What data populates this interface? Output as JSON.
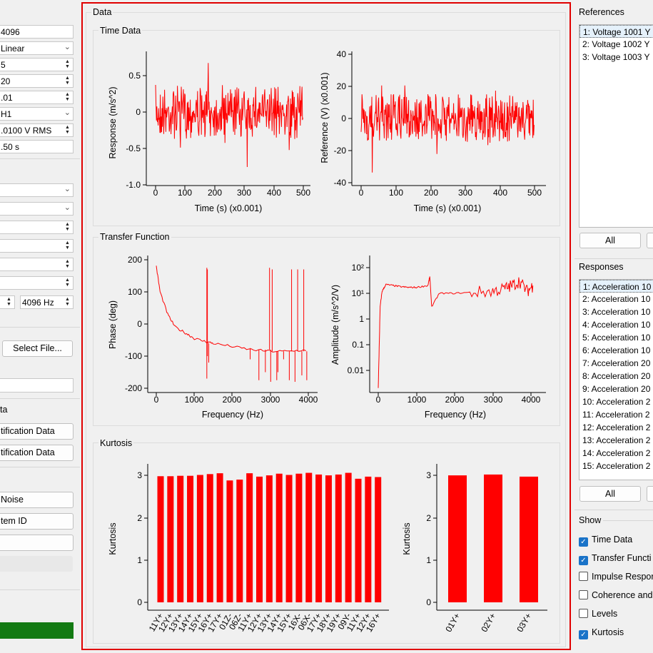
{
  "left_panel": {
    "fields": [
      {
        "text": "4096",
        "kind": "text"
      },
      {
        "text": "Linear",
        "kind": "combo"
      },
      {
        "text": "5",
        "kind": "spin"
      },
      {
        "text": "20",
        "kind": "spin"
      },
      {
        "text": ".01",
        "kind": "spin"
      },
      {
        "text": "H1",
        "kind": "combo"
      },
      {
        "text": ".0100 V RMS",
        "kind": "spin"
      },
      {
        "text": ".50 s",
        "kind": "text"
      }
    ],
    "freq_field": "4096 Hz",
    "select_file_label": "Select File...",
    "section_label_ta": "ta",
    "identification_buttons": [
      "tification Data",
      "tification Data"
    ],
    "noise_button": "Noise",
    "system_id_button": "tem ID"
  },
  "data_panel": {
    "title": "Data",
    "time_data": {
      "title": "Time Data",
      "response_plot": {
        "ylabel": "Response (m/s^2)",
        "xlabel": "Time (s) (x0.001)",
        "yticks": [
          "0.5",
          "0",
          "-0.5",
          "-1.0"
        ],
        "xticks": [
          "0",
          "100",
          "200",
          "300",
          "400",
          "500"
        ]
      },
      "reference_plot": {
        "ylabel": "Reference (V) (x0.001)",
        "xlabel": "Time (s) (x0.001)",
        "yticks": [
          "40",
          "20",
          "0",
          "-20",
          "-40"
        ],
        "xticks": [
          "0",
          "100",
          "200",
          "300",
          "400",
          "500"
        ]
      }
    },
    "transfer_function": {
      "title": "Transfer Function",
      "phase_plot": {
        "ylabel": "Phase (deg)",
        "xlabel": "Frequency (Hz)",
        "yticks": [
          "200",
          "100",
          "0",
          "-100",
          "-200"
        ],
        "xticks": [
          "0",
          "1000",
          "2000",
          "3000",
          "4000"
        ]
      },
      "amplitude_plot": {
        "ylabel": "Amplitude (m/s^2/V)",
        "xlabel": "Frequency (Hz)",
        "yticks": [
          "10²",
          "10¹",
          "1",
          "0.1",
          "0.01"
        ],
        "xticks": [
          "0",
          "1000",
          "2000",
          "3000",
          "4000"
        ]
      }
    },
    "kurtosis": {
      "title": "Kurtosis",
      "response_plot": {
        "ylabel": "Kurtosis",
        "yticks": [
          "3",
          "2",
          "1",
          "0"
        ]
      },
      "reference_plot": {
        "ylabel": "Kurtosis",
        "yticks": [
          "3",
          "2",
          "1",
          "0"
        ]
      }
    }
  },
  "chart_data": [
    {
      "type": "line",
      "title": "",
      "xlabel": "Time (s) (x0.001)",
      "ylabel": "Response (m/s^2)",
      "xlim": [
        0,
        500
      ],
      "ylim": [
        -1.0,
        0.7
      ],
      "series": [
        {
          "values": "random noise approx ±0.4"
        }
      ]
    },
    {
      "type": "line",
      "title": "",
      "xlabel": "Time (s) (x0.001)",
      "ylabel": "Reference (V) (x0.001)",
      "xlim": [
        0,
        500
      ],
      "ylim": [
        -40,
        40
      ],
      "series": [
        {
          "values": "random noise approx ±20"
        }
      ]
    },
    {
      "type": "line",
      "title": "",
      "xlabel": "Frequency (Hz)",
      "ylabel": "Phase (deg)",
      "xlim": [
        0,
        4096
      ],
      "ylim": [
        -200,
        200
      ],
      "x": [
        0,
        100,
        300,
        500,
        800,
        1000,
        1300,
        1500,
        2000,
        2500,
        3000,
        3500,
        4000
      ],
      "y": [
        180,
        100,
        30,
        -10,
        -30,
        -45,
        -55,
        -60,
        -70,
        -80,
        -85,
        -85,
        -80
      ]
    },
    {
      "type": "line",
      "title": "",
      "xlabel": "Frequency (Hz)",
      "ylabel": "Amplitude (m/s^2/V)",
      "log_y": true,
      "xlim": [
        0,
        4096
      ],
      "ylim": [
        0.002,
        150
      ],
      "x": [
        0,
        50,
        100,
        200,
        400,
        600,
        800,
        1000,
        1300,
        1350,
        1400,
        1600,
        2000,
        2500,
        3000,
        3300,
        3500,
        3700,
        3900,
        4050
      ],
      "y": [
        0.002,
        3,
        12,
        22,
        20,
        18,
        17,
        17,
        20,
        45,
        3,
        10,
        10,
        11,
        12,
        15,
        20,
        30,
        12,
        20
      ]
    },
    {
      "type": "bar",
      "ylabel": "Kurtosis",
      "ylim": [
        0,
        3.2
      ],
      "categories": [
        "11Y+",
        "12Y+",
        "13Y+",
        "14Y+",
        "15Y+",
        "16Y+",
        "17Y+",
        "01Z-",
        "06Z-",
        "11Y+",
        "12Y+",
        "13Y+",
        "14Y+",
        "15Y+",
        "16X-",
        "06X-",
        "17Y+",
        "18Y+",
        "19Y+",
        "09Y-",
        "11Y+",
        "12Y+",
        "16Y+"
      ],
      "values": [
        2.98,
        2.98,
        2.99,
        2.99,
        3.01,
        3.03,
        3.05,
        2.88,
        2.9,
        3.05,
        2.97,
        3.0,
        3.04,
        3.01,
        3.04,
        3.06,
        3.02,
        3.0,
        3.02,
        3.06,
        2.92,
        2.97,
        2.96
      ]
    },
    {
      "type": "bar",
      "ylabel": "Kurtosis",
      "ylim": [
        0,
        3.2
      ],
      "categories": [
        "01Y+",
        "02Y+",
        "03Y+"
      ],
      "values": [
        3.0,
        3.02,
        2.97
      ]
    }
  ],
  "right_panel": {
    "references_title": "References",
    "references": [
      "1: Voltage 1001 Y",
      "2: Voltage 1002 Y",
      "3: Voltage 1003 Y"
    ],
    "all_button": "All",
    "responses_title": "Responses",
    "responses": [
      "1: Acceleration 10",
      "2: Acceleration 10",
      "3: Acceleration 10",
      "4: Acceleration 10",
      "5: Acceleration 10",
      "6: Acceleration 10",
      "7: Acceleration 20",
      "8: Acceleration 20",
      "9: Acceleration 20",
      "10: Acceleration 2",
      "11: Acceleration 2",
      "12: Acceleration 2",
      "13: Acceleration 2",
      "14: Acceleration 2",
      "15: Acceleration 2"
    ],
    "show_title": "Show",
    "show_options": [
      {
        "label": "Time Data",
        "checked": true
      },
      {
        "label": "Transfer Functi",
        "checked": true
      },
      {
        "label": "Impulse Respor",
        "checked": false
      },
      {
        "label": "Coherence and",
        "checked": false
      },
      {
        "label": "Levels",
        "checked": false
      },
      {
        "label": "Kurtosis",
        "checked": true
      }
    ]
  },
  "colors": {
    "plot": "#ff0000",
    "selection": "#e5f1fb",
    "highlight_border": "#e00000",
    "status_bar": "#137a13",
    "check": "#1a73c8"
  }
}
